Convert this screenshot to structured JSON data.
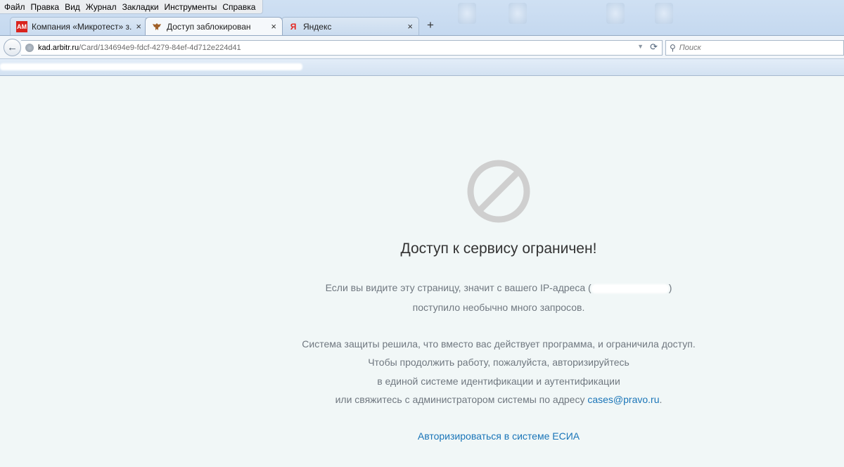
{
  "menubar": {
    "items": [
      "Файл",
      "Правка",
      "Вид",
      "Журнал",
      "Закладки",
      "Инструменты",
      "Справка"
    ]
  },
  "tabs": [
    {
      "title": "Компания «Микротест» з...",
      "favicon": "AM",
      "active": false
    },
    {
      "title": "Доступ заблокирован",
      "favicon": "eagle",
      "active": true
    },
    {
      "title": "Яндекс",
      "favicon": "Я",
      "active": false
    }
  ],
  "new_tab_label": "+",
  "close_label": "×",
  "url": {
    "host": "kad.arbitr.ru",
    "path": "/Card/134694e9-fdcf-4279-84ef-4d712e224d41"
  },
  "search": {
    "placeholder": "Поиск"
  },
  "page": {
    "title": "Доступ к сервису ограничен!",
    "p1_before": "Если вы видите эту страницу, значит с вашего IP-адреса (",
    "p1_after": ")",
    "p2": "поступило необычно много запросов.",
    "p3": "Система защиты решила, что вместо вас действует программа, и ограничила доступ.",
    "p4": "Чтобы продолжить работу, пожалуйста, авторизируйтесь",
    "p5": "в единой системе идентификации и аутентификации",
    "p6_before": "или свяжитесь с администратором системы по адресу ",
    "email": "cases@pravo.ru",
    "p6_after": ".",
    "esia_link": "Авторизироваться в системе ЕСИА"
  },
  "colors": {
    "link": "#1a75b8",
    "text": "#707880",
    "title": "#333333",
    "background": "#f1f7f7",
    "block_icon": "#cfcfcf"
  }
}
